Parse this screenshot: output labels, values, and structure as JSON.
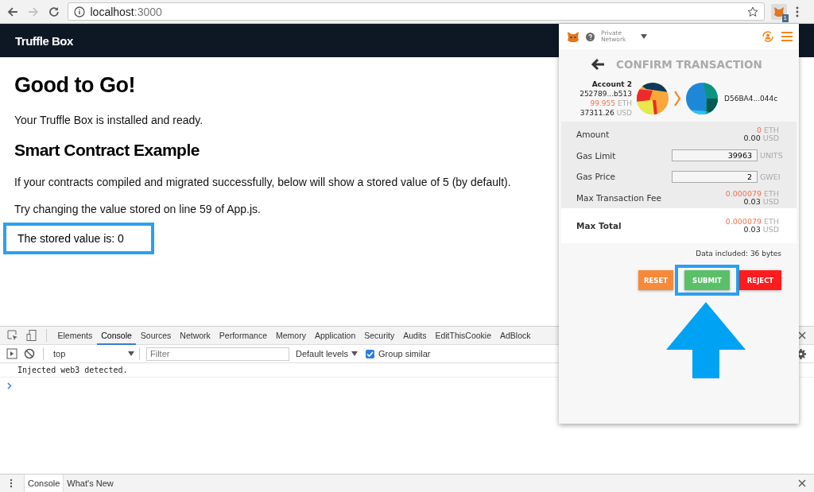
{
  "browser": {
    "url_host": "localhost",
    "url_port": ":3000",
    "extension_badge": "1"
  },
  "navbar": {
    "brand": "Truffle Box"
  },
  "page": {
    "heading": "Good to Go!",
    "intro": "Your Truffle Box is installed and ready.",
    "subheading": "Smart Contract Example",
    "paragraphs": [
      "If your contracts compiled and migrated successfully, below will show a stored value of 5 (by default).",
      "Try changing the value stored on line 59 of App.js."
    ],
    "stored_value": {
      "text": "The stored value is: 0",
      "highlighted": true
    }
  },
  "devtools": {
    "tabs": [
      {
        "label": "Elements",
        "selected": false
      },
      {
        "label": "Console",
        "selected": true
      },
      {
        "label": "Sources",
        "selected": false
      },
      {
        "label": "Network",
        "selected": false
      },
      {
        "label": "Performance",
        "selected": false
      },
      {
        "label": "Memory",
        "selected": false
      },
      {
        "label": "Application",
        "selected": false
      },
      {
        "label": "Security",
        "selected": false
      },
      {
        "label": "Audits",
        "selected": false
      },
      {
        "label": "EditThisCookie",
        "selected": false
      },
      {
        "label": "AdBlock",
        "selected": false
      }
    ],
    "context": "top",
    "filter": {
      "placeholder": "Filter"
    },
    "levels": "Default levels",
    "group_similar": {
      "label": "Group similar",
      "checked": true
    },
    "log": [
      "Injected web3 detected."
    ],
    "drawer_tabs": [
      {
        "label": "Console",
        "selected": true
      },
      {
        "label": "What's New",
        "selected": false
      }
    ]
  },
  "metamask": {
    "network": "Private Network",
    "title": "CONFIRM TRANSACTION",
    "from": {
      "name": "Account 2",
      "address": "252789...b513",
      "eth": "99.955",
      "eth_unit": "ETH",
      "usd": "37311.26",
      "usd_unit": "USD"
    },
    "to": {
      "address": "D56BA4...044c"
    },
    "rows": [
      {
        "kind": "amount",
        "label": "Amount",
        "eth": "0",
        "eth_unit": "ETH",
        "usd": "0.00",
        "usd_unit": "USD"
      },
      {
        "kind": "input",
        "label": "Gas Limit",
        "value": "39963",
        "unit": "UNITS"
      },
      {
        "kind": "input",
        "label": "Gas Price",
        "value": "2",
        "unit": "GWEI"
      },
      {
        "kind": "amount",
        "label": "Max Transaction Fee",
        "eth": "0.000079",
        "eth_unit": "ETH",
        "usd": "0.03",
        "usd_unit": "USD"
      }
    ],
    "total": {
      "label": "Max Total",
      "eth": "0.000079",
      "eth_unit": "ETH",
      "usd": "0.03",
      "usd_unit": "USD"
    },
    "data_note": "Data included: 36 bytes",
    "buttons": [
      {
        "kind": "reset",
        "label": "RESET",
        "highlighted": false
      },
      {
        "kind": "submit",
        "label": "SUBMIT",
        "highlighted": true
      },
      {
        "kind": "reject",
        "label": "REJECT",
        "highlighted": false
      }
    ]
  }
}
